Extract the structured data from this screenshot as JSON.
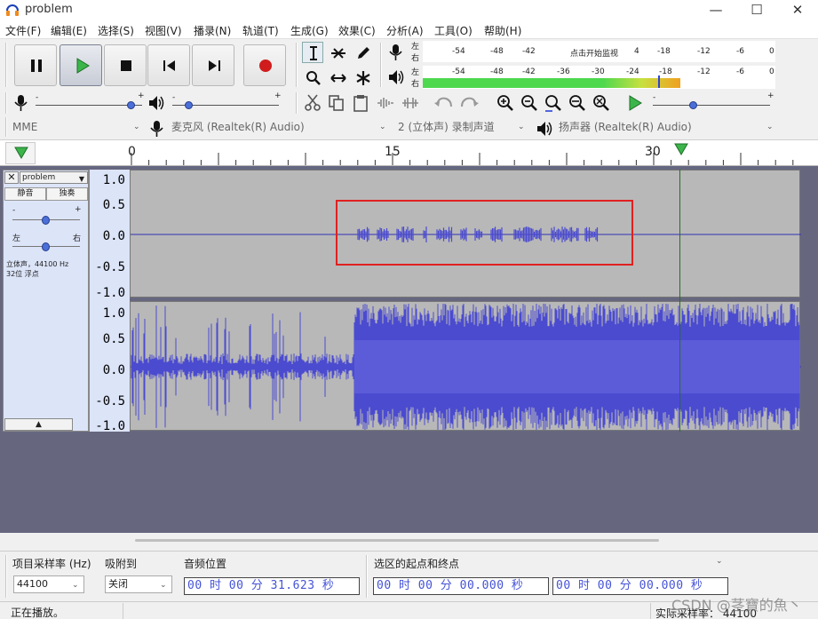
{
  "window": {
    "title": "problem"
  },
  "menu": [
    "文件(F)",
    "编辑(E)",
    "选择(S)",
    "视图(V)",
    "播录(N)",
    "轨道(T)",
    "生成(G)",
    "效果(C)",
    "分析(A)",
    "工具(O)",
    "帮助(H)"
  ],
  "meter": {
    "rec_ticks": [
      "-54",
      "-48",
      "-42",
      "点击开始监视",
      "4",
      "-18",
      "-12",
      "-6",
      "0"
    ],
    "play_ticks": [
      "-54",
      "-48",
      "-42",
      "-36",
      "-30",
      "-24",
      "-18",
      "-12",
      "-6",
      "0"
    ],
    "left": "左",
    "right": "右",
    "play_level_green": 0.73
  },
  "device": {
    "host": "MME",
    "mic": "麦克风 (Realtek(R) Audio)",
    "channels": "2 (立体声) 录制声道",
    "speaker": "扬声器 (Realtek(R) Audio)"
  },
  "timeline": {
    "ticks": [
      "0",
      "15",
      "30"
    ]
  },
  "track": {
    "name": "problem",
    "mute": "静音",
    "solo": "独奏",
    "pan_left": "左",
    "pan_right": "右",
    "info1": "立体声，44100 Hz",
    "info2": "32位 浮点",
    "vruler": [
      "1.0",
      "0.5",
      "0.0",
      "-0.5",
      "-1.0"
    ]
  },
  "bottom": {
    "rate_label": "项目采样率 (Hz)",
    "rate_value": "44100",
    "snap_label": "吸附到",
    "snap_value": "关闭",
    "pos_label": "音频位置",
    "pos_value": "00 时 00 分 31.623 秒",
    "sel_label": "选区的起点和终点",
    "sel_start": "00 时 00 分 00.000 秒",
    "sel_end": "00 时 00 分 00.000 秒"
  },
  "status": {
    "text": "正在播放。",
    "actual_rate": "实际采样率： 44100",
    "watermark": "CSDN @茎寶的魚丶"
  },
  "colors": {
    "wave": "#4b4bd0",
    "wave_dark": "#3232b4",
    "record": "#d01c1c",
    "play": "#2ea043",
    "highlight_box": "#e02020"
  }
}
